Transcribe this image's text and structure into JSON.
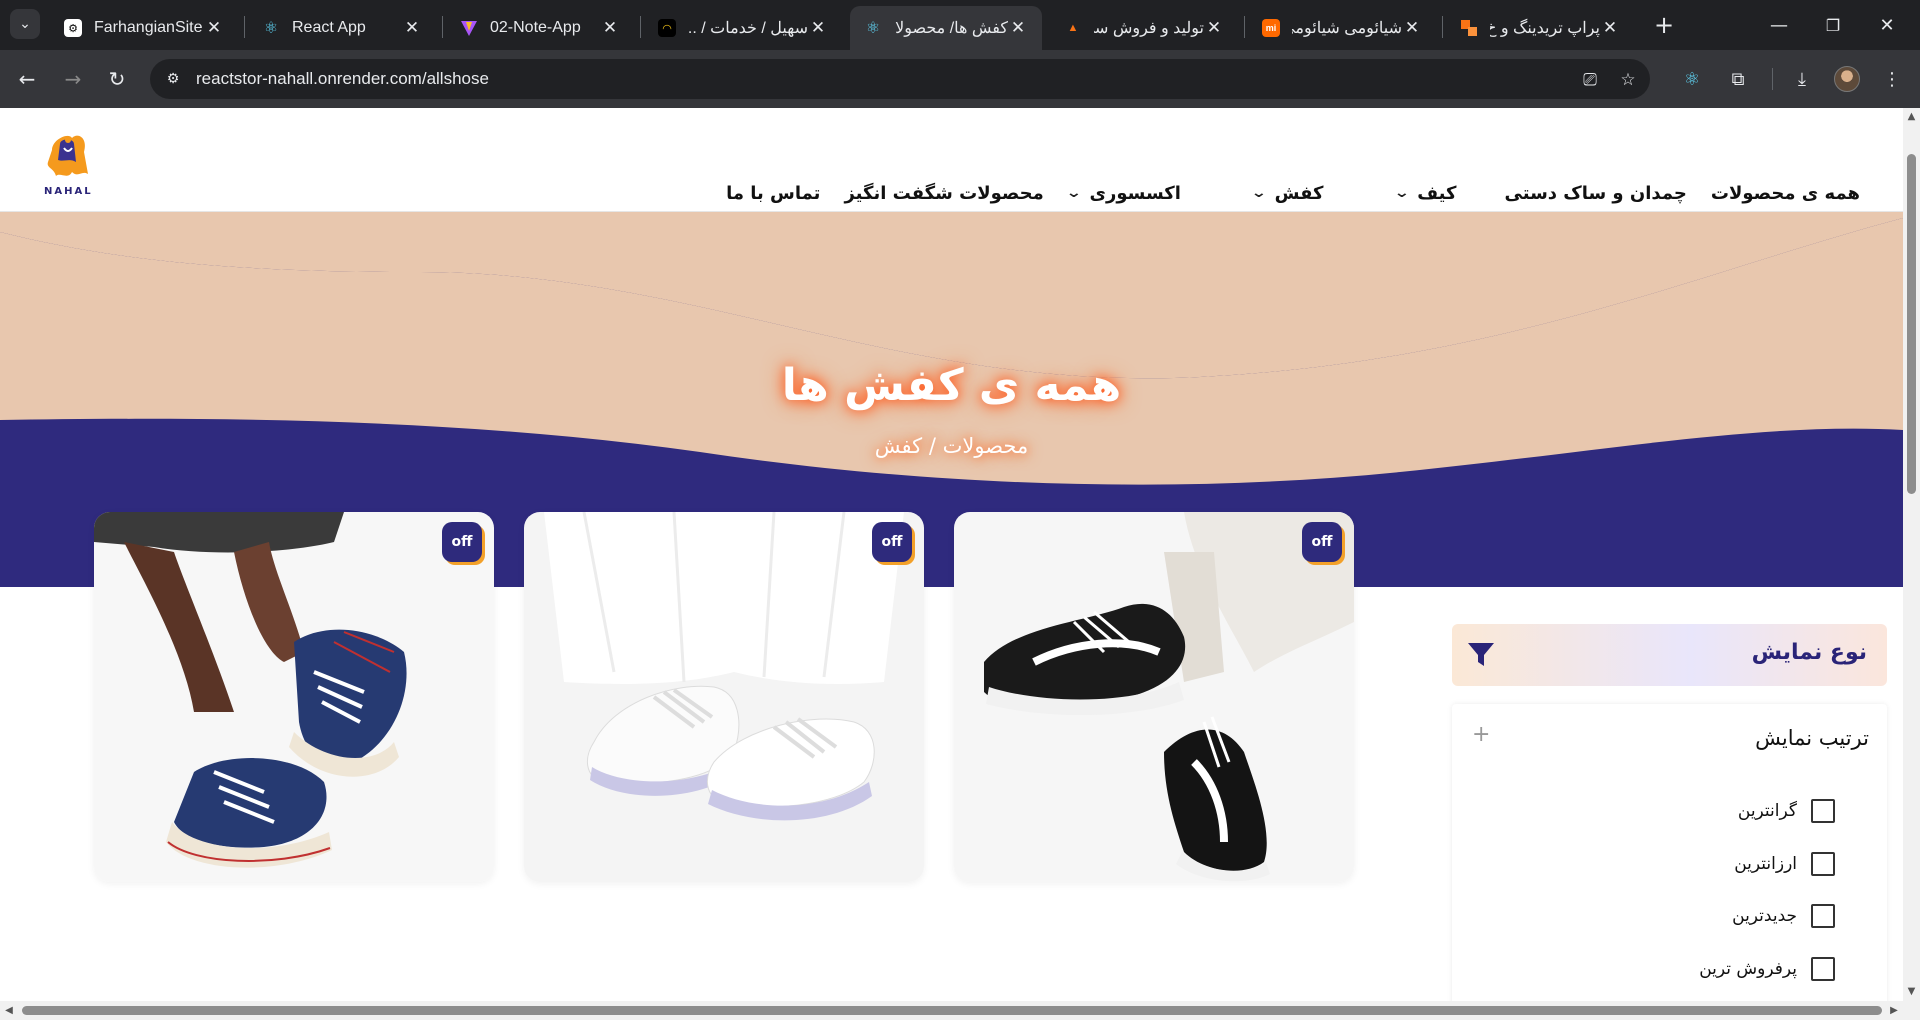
{
  "browser": {
    "tabs": [
      {
        "title": "FarhangianSite -",
        "favicon": "farhangian-icon",
        "active": false
      },
      {
        "title": "React App",
        "favicon": "react-icon",
        "active": false
      },
      {
        "title": "02-Note-App",
        "favicon": "vite-icon",
        "active": false
      },
      {
        "title": "سهیل / خدمات / ...",
        "favicon": "soheil-icon",
        "active": false
      },
      {
        "title": "کفش ها/ محصولا",
        "favicon": "react-icon",
        "active": true
      },
      {
        "title": "تولید و فروش سی...",
        "favicon": "rocket-icon",
        "active": false
      },
      {
        "title": "شیائومی شیائومی...",
        "favicon": "mi-icon",
        "active": false
      },
      {
        "title": "پراپ تریدینگ و خ...",
        "favicon": "prop-icon",
        "active": false
      }
    ],
    "url": "reactstor-nahall.onrender.com/allshose",
    "close_glyph": "✕",
    "new_tab_glyph": "+",
    "window_controls": {
      "minimize": "—",
      "restore": "❐",
      "close": "✕"
    }
  },
  "site": {
    "logo_text": "NAHAL",
    "nav": [
      {
        "label": "همه ی محصولات",
        "has_dropdown": false
      },
      {
        "label": "چمدان و ساک دستی",
        "has_dropdown": false
      },
      {
        "label": "کیف",
        "has_dropdown": true
      },
      {
        "label": "کفش",
        "has_dropdown": true
      },
      {
        "label": "اکسسوری",
        "has_dropdown": true
      },
      {
        "label": "محصولات شگفت انگیز",
        "has_dropdown": false
      },
      {
        "label": "تماس با ما",
        "has_dropdown": false
      }
    ],
    "hero": {
      "title": "همه ی کفش ها",
      "breadcrumb": "محصولات / کفش"
    },
    "products": [
      {
        "badge": "off",
        "image": "black-sneakers-photo"
      },
      {
        "badge": "off",
        "image": "white-sneakers-photo"
      },
      {
        "badge": "off",
        "image": "navy-high-top-sneakers-photo"
      }
    ],
    "sidebar": {
      "filter_title": "نوع نمایش",
      "sort_title": "ترتیب نمایش",
      "sort_options": [
        "گرانترین",
        "ارزانترین",
        "جدیدترین",
        "پرفروش ترین"
      ]
    }
  },
  "colors": {
    "hero_navy": "#2f2a7e",
    "hero_peach": "#e8c7ae",
    "badge_bg": "#2e2a7c",
    "badge_accent": "#f3a12a",
    "heading_navy": "#2a2478"
  }
}
